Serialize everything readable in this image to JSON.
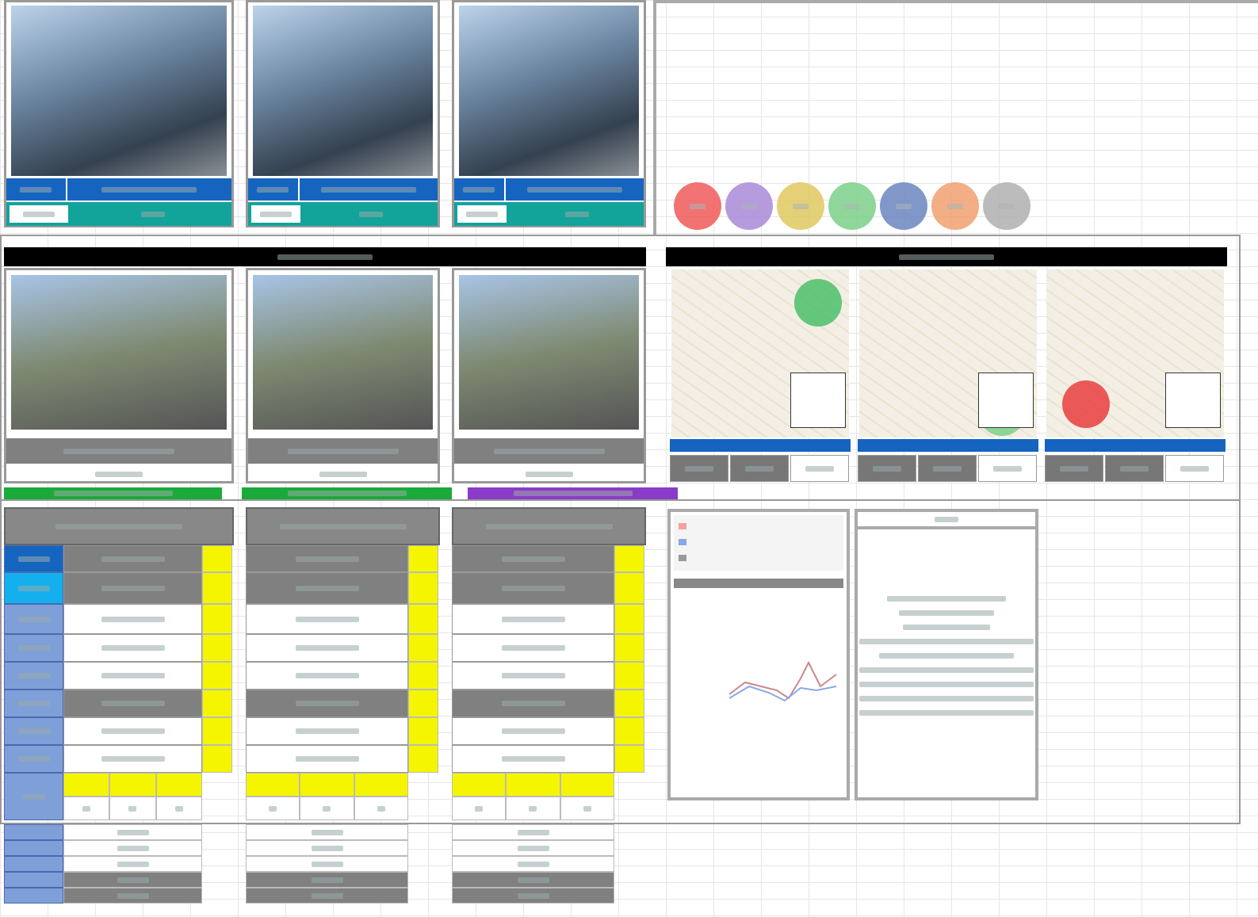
{
  "colors": {
    "blue": "#1565c0",
    "teal": "#12a39a",
    "gray": "#808080",
    "yellow": "#f5f500",
    "black": "#000000",
    "green": "#1aaa3a",
    "purple": "#8a3cc8"
  },
  "legend_circles": [
    "#f05a5a",
    "#a98ad8",
    "#e0c860",
    "#7cd08a",
    "#6b86c0",
    "#f0a070",
    "#b0b0b0"
  ],
  "top_cards": 3,
  "middle_photos": 3,
  "maps": 3,
  "strips": [
    "#1aaa3a",
    "#1aaa3a",
    "#8a3cc8"
  ],
  "table_columns": 3,
  "row_label_colors": [
    "#1565c0",
    "#14b0ee",
    "#7f9fd8",
    "#7f9fd8",
    "#7f9fd8",
    "#7f9fd8",
    "#7f9fd8",
    "#7f9fd8",
    "#7f9fd8"
  ]
}
